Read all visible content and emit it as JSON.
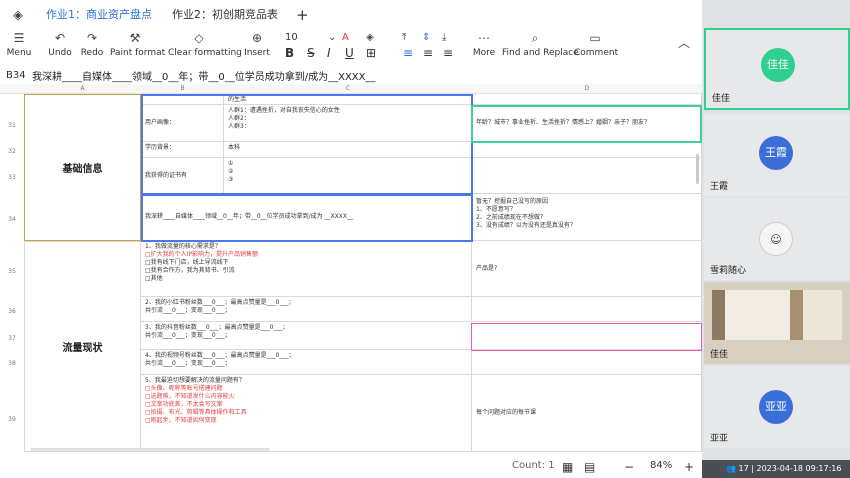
{
  "tabs": {
    "items": [
      {
        "label": "作业1：商业资产盘点",
        "active": true
      },
      {
        "label": "作业2：初创期竞品表",
        "active": false
      }
    ],
    "add_label": "+"
  },
  "toolbar": {
    "menu": "Menu",
    "undo": "Undo",
    "redo": "Redo",
    "paint_format": "Paint format",
    "clear_formatting": "Clear formatting",
    "insert": "Insert",
    "font_size": "10",
    "bold": "B",
    "strike": "S",
    "italic": "I",
    "underline": "U",
    "more": "More",
    "find_replace": "Find and Replace",
    "comment": "Comment"
  },
  "formula_bar": {
    "cell_ref": "B34",
    "content": "我深耕____自媒体____领域__0__年；带__0__位学员成功拿到/成为__XXXX__"
  },
  "columns": [
    "A",
    "B",
    "C",
    "D"
  ],
  "rows": {
    "r30": {
      "num": "",
      "c": "的生活"
    },
    "r31": {
      "num": "31",
      "b": "用户画像：",
      "c": [
        "人群1：遭遇挫折，对自我丧失信心的女性",
        "人群2：",
        "人群3："
      ],
      "d": "年龄？城市？事业挫折、生活挫折？情感上？婚姻？亲子？朋友？"
    },
    "r32": {
      "num": "32",
      "b": "学历背景：",
      "c": "本科"
    },
    "r33": {
      "num": "33",
      "b": "我获得的证书有",
      "c": [
        "①",
        "②",
        "③"
      ]
    },
    "r34": {
      "num": "34",
      "b": "我深耕____自媒体____领域__0__年；带__0__位学员成功拿到/成为 __XXXX__",
      "d": [
        "暂无？挖掘自己没写的原因",
        "1、不愿意写？",
        "2、之前成绩现在不想做？",
        "3、没有成绩？以为没有还是真没有？"
      ]
    },
    "r35": {
      "num": "35",
      "b": [
        "1、我做流量的核心需求是？",
        "□扩大我的个人IP影响力，提升产品销售额",
        "□我有线下门店，线上导流线下",
        "□我有合作方，我为其背书、引流",
        "□其他"
      ],
      "d": "产品是?"
    },
    "r36": {
      "num": "36",
      "b": [
        "2、我的小红书粉丝数___0___；最高点赞量是___0___；",
        "   共引流___0___；变现___0___；"
      ]
    },
    "r37": {
      "num": "37",
      "b": [
        "3、我的抖音粉丝数___0___；最高点赞量是___0___；",
        "   共引流___0___；变现___0___；"
      ]
    },
    "r38": {
      "num": "38",
      "b": [
        "4、我的视频号粉丝数___0___；最高点赞量是___0___；",
        "   共引流___0___；变现___0___；"
      ]
    },
    "r39": {
      "num": "39",
      "b_title": "5、我最迫切想要解决的流量问题有？",
      "b_red": [
        "□头像、昵称等账号搭建问题",
        "□选题难，不知道发什么内容能火",
        "□文案功底差，不太会写文案",
        "□拍摄、布光、剪辑等具体操作和工具",
        "□刚起步，不知道如何变现"
      ],
      "d": "每个问题对应的每节课"
    }
  },
  "merged_labels": {
    "basic_info": "基础信息",
    "traffic_status": "流量现状"
  },
  "status_bar": {
    "count": "Count: 1",
    "zoom": "84%"
  },
  "participants": [
    {
      "name": "佳佳",
      "avatar": "佳佳",
      "color": "#2ecf8f",
      "active": true
    },
    {
      "name": "王霞",
      "avatar": "王霞",
      "color": "#3b6fd8",
      "active": false
    },
    {
      "name": "雪莉随心",
      "avatar": "",
      "color": "#f2f2f2",
      "active": false
    },
    {
      "name": "佳佳",
      "avatar": "",
      "color": "#c9b89a",
      "active": false
    },
    {
      "name": "亚亚",
      "avatar": "亚亚",
      "color": "#3b6fd8",
      "active": false
    }
  ],
  "meeting": {
    "participant_count": "17",
    "timestamp": "2023-04-18 09:17:16"
  }
}
